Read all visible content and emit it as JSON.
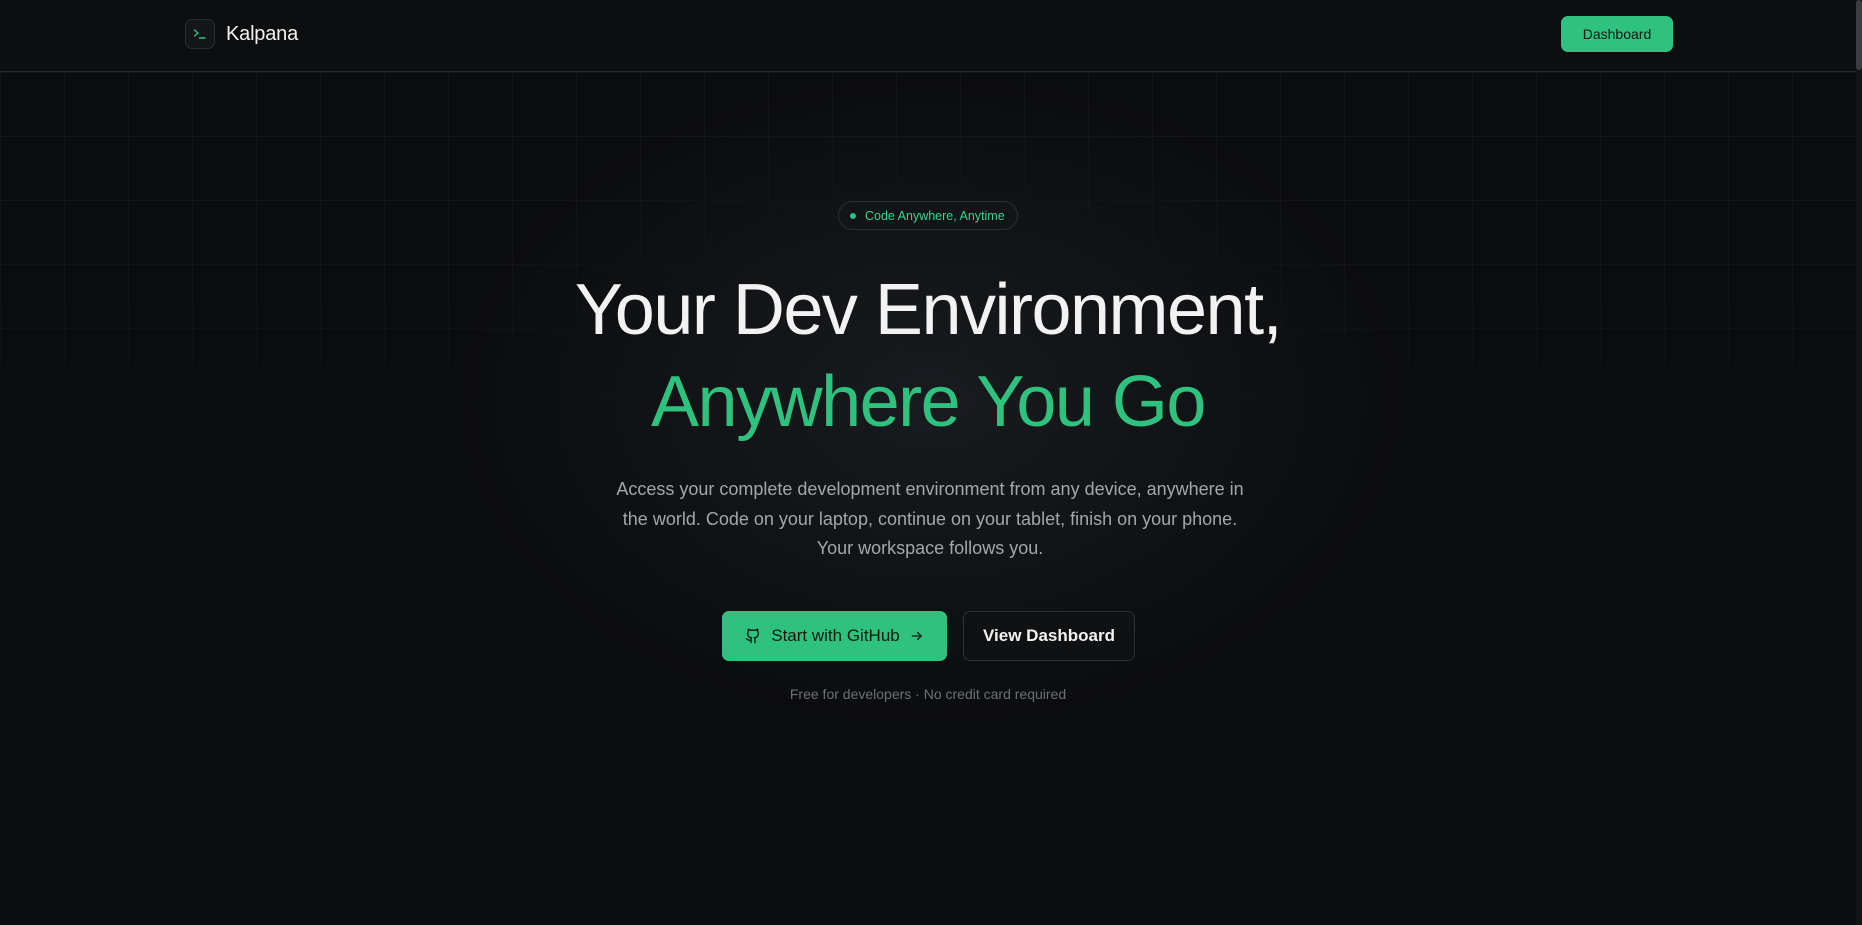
{
  "header": {
    "brand": "Kalpana",
    "logo_icon": "terminal-prompt-icon",
    "dashboard_label": "Dashboard"
  },
  "hero": {
    "badge": "Code Anywhere, Anytime",
    "headline_line1": "Your Dev Environment,",
    "headline_line2": "Anywhere You Go",
    "subtext": "Access your complete development environment from any device, anywhere in the world. Code on your laptop, continue on your tablet, finish on your phone. Your workspace follows you.",
    "primary_cta": "Start with GitHub",
    "primary_cta_icon": "github-icon",
    "primary_cta_trailing_icon": "arrow-right-icon",
    "secondary_cta": "View Dashboard",
    "footnote": "Free for developers · No credit card required"
  },
  "colors": {
    "background": "#0b0c0e",
    "accent": "#2ec27e",
    "text": "#f2f2f2",
    "muted": "#a3a6ab"
  }
}
